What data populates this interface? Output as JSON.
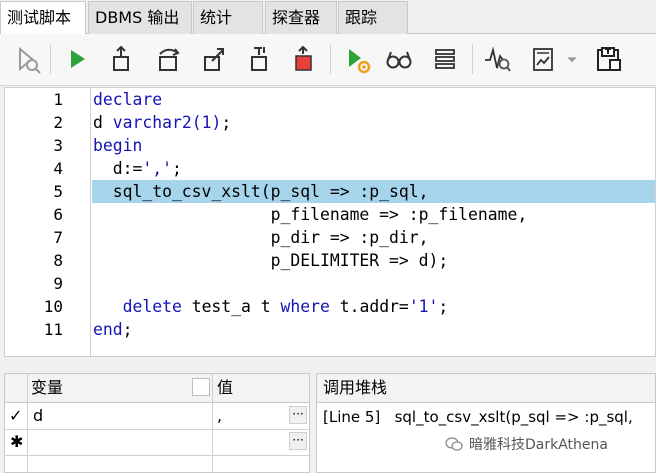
{
  "tabs": [
    {
      "label": "测试脚本",
      "active": true
    },
    {
      "label": "DBMS 输出",
      "active": false
    },
    {
      "label": "统计",
      "active": false
    },
    {
      "label": "探查器",
      "active": false
    },
    {
      "label": "跟踪",
      "active": false
    }
  ],
  "toolbar": {
    "icons": [
      "debug-search-icon",
      "run-icon",
      "step-into-icon",
      "step-over-icon",
      "step-out-icon",
      "run-to-cursor-icon",
      "stop-icon",
      "run-to-exception-icon",
      "watch-glasses-icon",
      "stack-icon",
      "profiler-icon",
      "report-icon",
      "dropdown-chevron-icon",
      "save-icon"
    ]
  },
  "editor": {
    "highlighted_line": 5,
    "lines": [
      {
        "num": "1",
        "segments": [
          {
            "t": "declare",
            "c": "kw"
          }
        ]
      },
      {
        "num": "2",
        "segments": [
          {
            "t": "d ",
            "c": ""
          },
          {
            "t": "varchar2",
            "c": "kw"
          },
          {
            "t": "(1)",
            "c": "str"
          },
          {
            "t": ";",
            "c": ""
          }
        ]
      },
      {
        "num": "3",
        "segments": [
          {
            "t": "begin",
            "c": "kw"
          }
        ]
      },
      {
        "num": "4",
        "segments": [
          {
            "t": "  d:=",
            "c": ""
          },
          {
            "t": "','",
            "c": "str"
          },
          {
            "t": ";",
            "c": ""
          }
        ]
      },
      {
        "num": "5",
        "segments": [
          {
            "t": "  sql_to_csv_xslt(p_sql => :p_sql,",
            "c": ""
          }
        ]
      },
      {
        "num": "6",
        "segments": [
          {
            "t": "                  p_filename => :p_filename,",
            "c": ""
          }
        ]
      },
      {
        "num": "7",
        "segments": [
          {
            "t": "                  p_dir => :p_dir,",
            "c": ""
          }
        ]
      },
      {
        "num": "8",
        "segments": [
          {
            "t": "                  p_DELIMITER => d);",
            "c": ""
          }
        ]
      },
      {
        "num": "9",
        "segments": [
          {
            "t": "",
            "c": ""
          }
        ]
      },
      {
        "num": "10",
        "segments": [
          {
            "t": "   ",
            "c": ""
          },
          {
            "t": "delete",
            "c": "kw"
          },
          {
            "t": " test_a t ",
            "c": ""
          },
          {
            "t": "where",
            "c": "kw"
          },
          {
            "t": " t.addr=",
            "c": ""
          },
          {
            "t": "'1'",
            "c": "str"
          },
          {
            "t": ";",
            "c": ""
          }
        ]
      },
      {
        "num": "11",
        "segments": [
          {
            "t": "end",
            "c": "kw"
          },
          {
            "t": ";",
            "c": ""
          }
        ]
      }
    ]
  },
  "variables": {
    "col_var": "变量",
    "col_val": "值",
    "rows": [
      {
        "marker": "✓",
        "name": "d",
        "value": ","
      },
      {
        "marker": "✱",
        "name": "",
        "value": ""
      }
    ],
    "ellipsis": "···"
  },
  "callstack": {
    "title": "调用堆栈",
    "rows": [
      {
        "line": "[Line 5]",
        "text": "sql_to_csv_xslt(p_sql => :p_sql,"
      }
    ]
  },
  "watermark": "暗雅科技DarkAthena",
  "colors": {
    "keyword": "#1414b4",
    "highlight": "#a6d4ea",
    "run_green": "#2fa33a",
    "stop_red": "#e8403a"
  }
}
